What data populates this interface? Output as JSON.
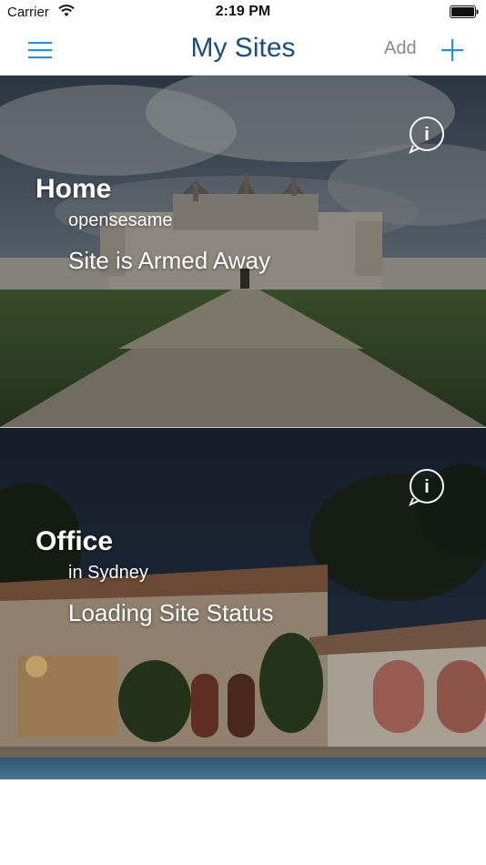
{
  "status_bar": {
    "carrier": "Carrier",
    "time": "2:19 PM"
  },
  "nav": {
    "title": "My Sites",
    "add_label": "Add",
    "icons": {
      "menu": "hamburger-menu-icon",
      "add": "plus-icon"
    },
    "accent_color": "#2b8fd6",
    "title_color": "#1f4d7a"
  },
  "sites": [
    {
      "name": "Home",
      "subtitle": "opensesame",
      "status": "Site is Armed Away",
      "image": "castle-photo"
    },
    {
      "name": "Office",
      "subtitle": "in Sydney",
      "status": "Loading Site Status",
      "image": "villa-night-photo"
    }
  ]
}
